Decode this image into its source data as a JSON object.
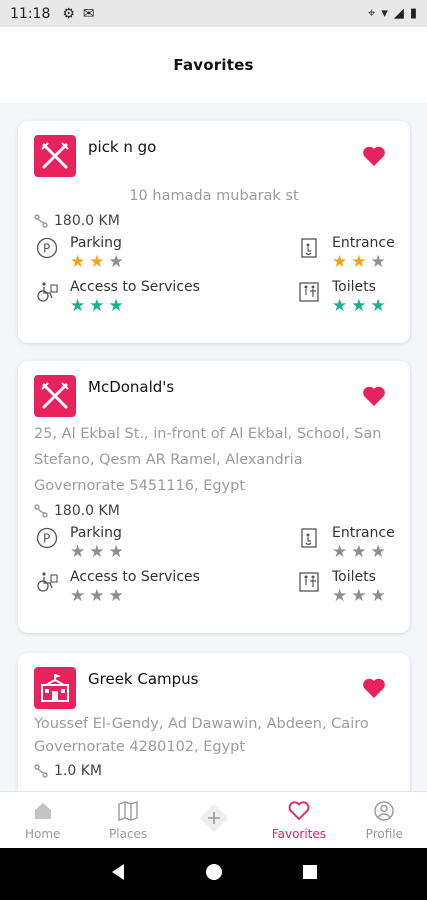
{
  "status_bar": {
    "time": "11:18"
  },
  "app_bar": {
    "title": "Favorites"
  },
  "colors": {
    "accent": "#e8225d",
    "star_orange": "#f4a21a",
    "star_green": "#15b38a",
    "star_gray": "#8f8f8f"
  },
  "labels": {
    "distance_unit_suffix": ""
  },
  "places": [
    {
      "name": "pick n go",
      "logo_icon": "fork-knife-icon",
      "address": "10 hamada mubarak st",
      "distance": "180.0 KM",
      "attributes": [
        {
          "label": "Parking",
          "icon": "parking-icon",
          "rating": 2,
          "color": "orange"
        },
        {
          "label": "Entrance",
          "icon": "entrance-icon",
          "rating": 2,
          "color": "orange"
        },
        {
          "label": "Access to Services",
          "icon": "wheelchair-icon",
          "rating": 3,
          "color": "green"
        },
        {
          "label": "Toilets",
          "icon": "toilet-icon",
          "rating": 3,
          "color": "green"
        }
      ]
    },
    {
      "name": "McDonald's",
      "logo_icon": "fork-knife-icon",
      "address_lines": [
        "25, Al Ekbal St., in-front of Al Ekbal, School, San",
        "Stefano, Qesm AR Ramel, Alexandria",
        "Governorate 5451116, Egypt"
      ],
      "distance": "180.0 KM",
      "attributes": [
        {
          "label": "Parking",
          "icon": "parking-icon",
          "rating": 0
        },
        {
          "label": "Entrance",
          "icon": "entrance-icon",
          "rating": 0
        },
        {
          "label": "Access to Services",
          "icon": "wheelchair-icon",
          "rating": 0
        },
        {
          "label": "Toilets",
          "icon": "toilet-icon",
          "rating": 0
        }
      ]
    },
    {
      "name": "Greek Campus",
      "logo_icon": "school-building-icon",
      "address_lines": [
        "Youssef El-Gendy, Ad Dawawin, Abdeen, Cairo",
        "Governorate 4280102, Egypt"
      ],
      "distance": "1.0 KM"
    }
  ],
  "bottom_nav": {
    "home": "Home",
    "places": "Places",
    "favorites": "Favorites",
    "profile": "Profile"
  }
}
